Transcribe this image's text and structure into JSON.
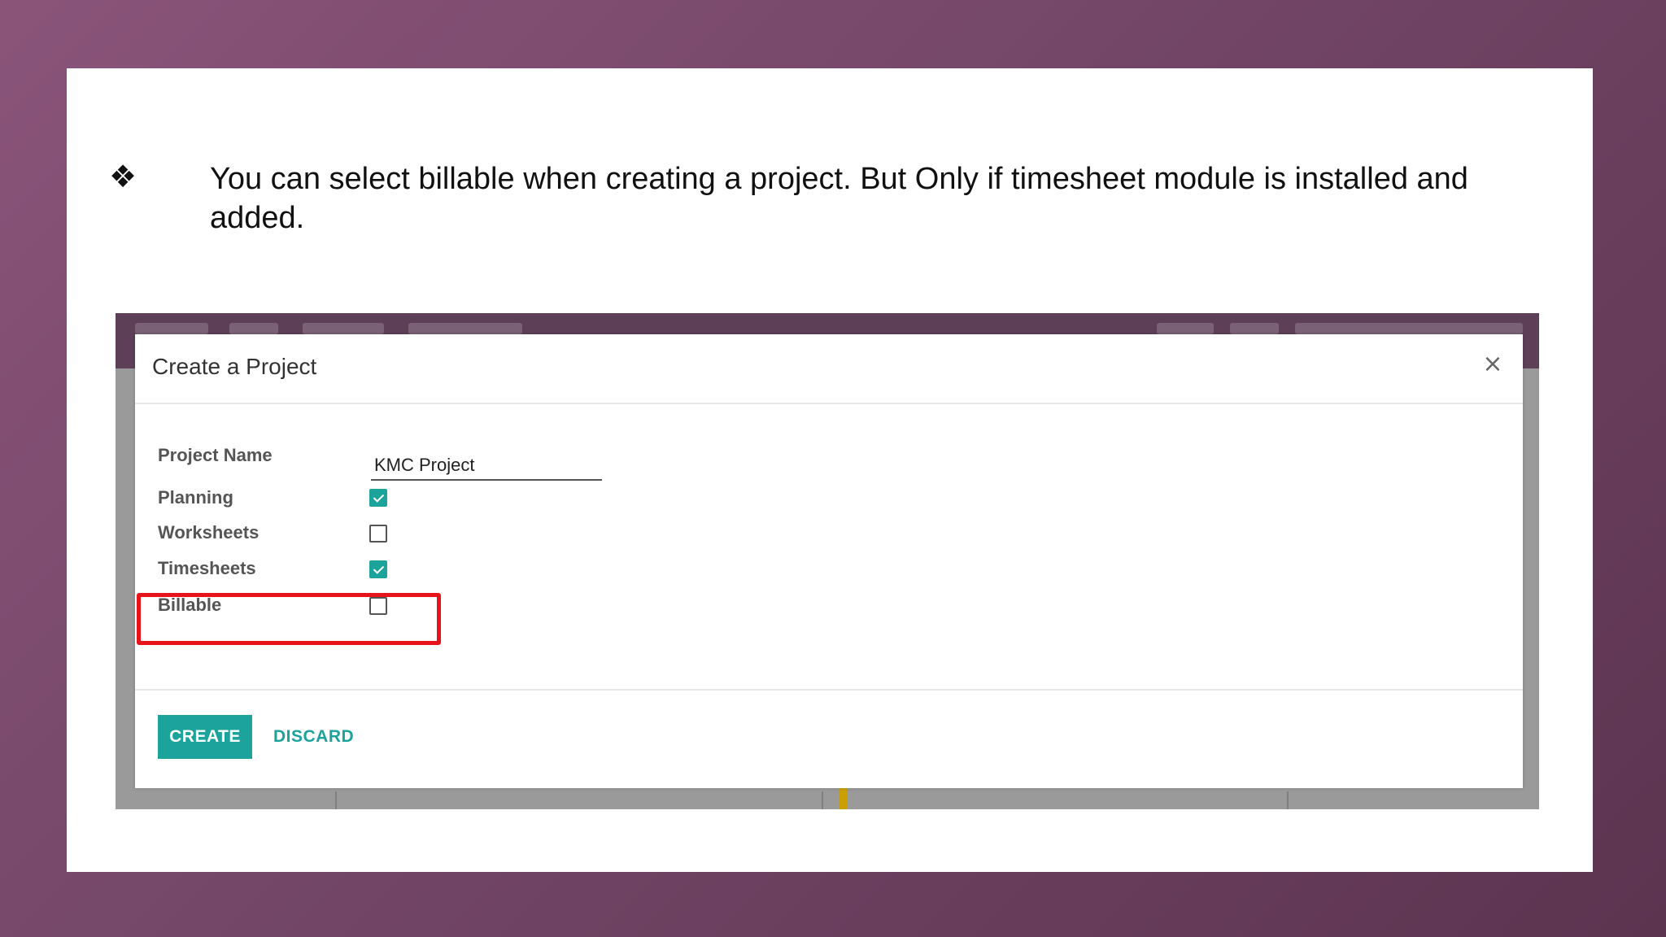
{
  "slide": {
    "bullet_glyph": "❖",
    "bullet_text": "You can select billable when creating a project. But Only if timesheet module is installed and added."
  },
  "dialog": {
    "title": "Create a Project",
    "close_glyph": "×",
    "fields": {
      "project_name_label": "Project Name",
      "project_name_value": "KMC Project",
      "planning_label": "Planning",
      "planning_checked": true,
      "worksheets_label": "Worksheets",
      "worksheets_checked": false,
      "timesheets_label": "Timesheets",
      "timesheets_checked": true,
      "billable_label": "Billable",
      "billable_checked": false
    },
    "buttons": {
      "create_label": "CREATE",
      "discard_label": "DISCARD"
    }
  },
  "colors": {
    "accent": "#1ba39c",
    "highlight": "#e8121b",
    "topbar": "#5d3f58"
  }
}
